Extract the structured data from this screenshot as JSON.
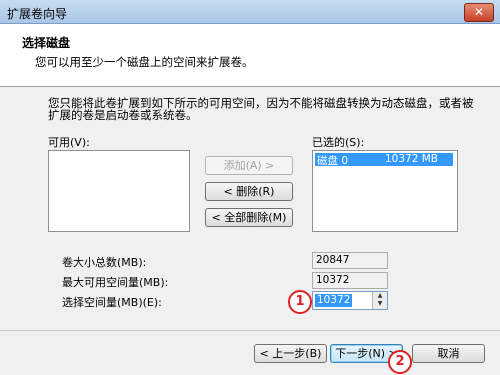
{
  "window": {
    "title": "扩展卷向导",
    "close_glyph": "✕"
  },
  "header": {
    "title": "选择磁盘",
    "subtitle": "您可以用至少一个磁盘上的空间来扩展卷。"
  },
  "description": "您只能将此卷扩展到如下所示的可用空间，因为不能将磁盘转换为动态磁盘，或者被扩展的卷是启动卷或系统卷。",
  "available": {
    "label": "可用(V):",
    "items": []
  },
  "selected": {
    "label": "已选的(S):",
    "items": [
      {
        "disk": "磁盘 0",
        "size": "10372 MB"
      }
    ]
  },
  "middle_buttons": {
    "add": "添加(A) >",
    "remove": "< 删除(R)",
    "remove_all": "< 全部删除(M)"
  },
  "fields": {
    "total_label": "卷大小总数(MB):",
    "total_value": "20847",
    "max_label": "最大可用空间量(MB):",
    "max_value": "10372",
    "select_label": "选择空间量(MB)(E):",
    "select_value": "10372"
  },
  "footer": {
    "back": "< 上一步(B)",
    "next": "下一步(N) >",
    "cancel": "取消"
  },
  "markers": {
    "one": "1",
    "two": "2"
  },
  "colors": {
    "accent": "#3399ff",
    "marker": "#dd2222"
  }
}
